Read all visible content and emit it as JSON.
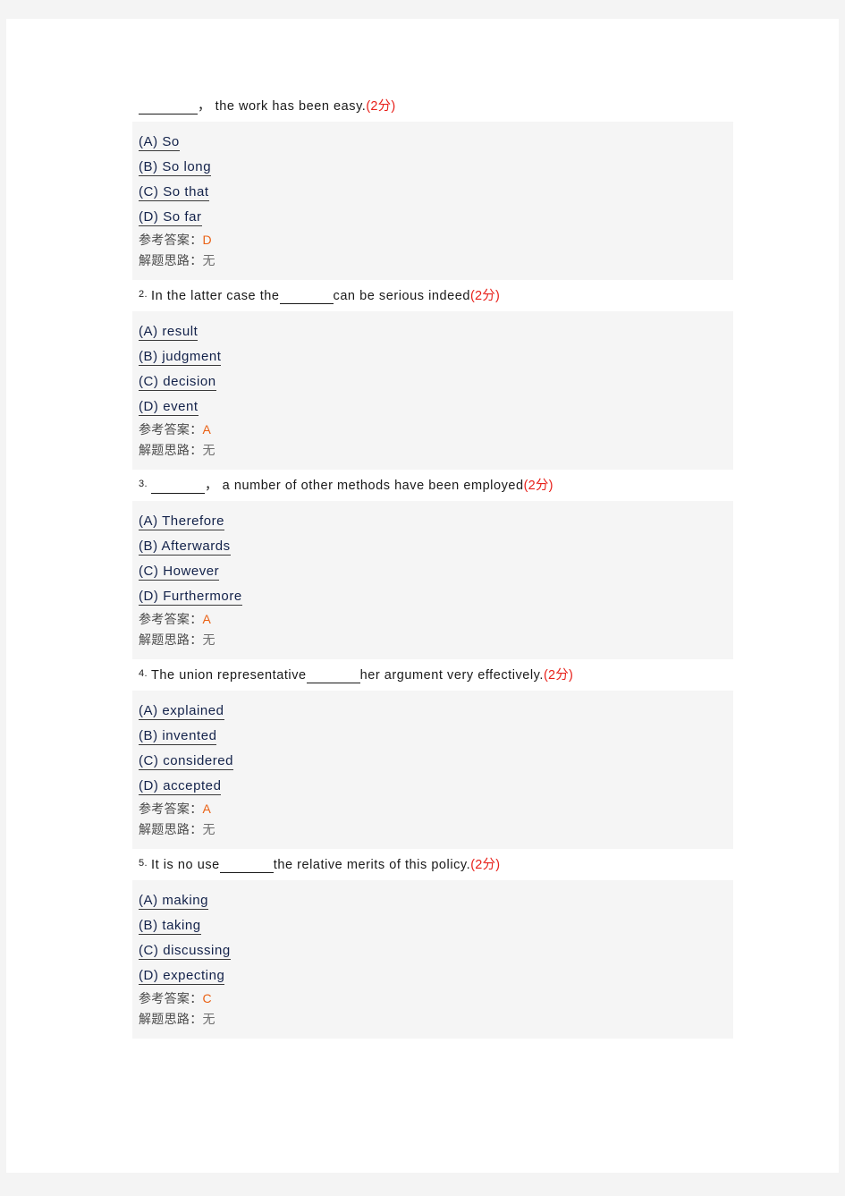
{
  "page": {
    "background_color": "#f4f4f4",
    "paper_color": "#ffffff",
    "block_color": "#f5f5f5",
    "points_color": "#e8201a",
    "answer_color": "#ea6216",
    "option_color": "#13224a"
  },
  "labels": {
    "answer_label": "参考答案：",
    "explain_label": "解题思路：",
    "explain_value": "无",
    "points": "(2分)"
  },
  "questions": [
    {
      "number": "",
      "stem_before": "",
      "stem_after": "， the work has been easy.",
      "truncated": true,
      "points": "(2分)",
      "options": [
        "(A)  So ",
        "(B)  So  long",
        "(C)  So  that",
        "(D)  So  far"
      ],
      "answer": "D",
      "explain": "无"
    },
    {
      "number": "2.",
      "stem_before": "In the latter case the",
      "stem_after": "can be serious indeed",
      "truncated": false,
      "points": "(2分)",
      "options": [
        "(A)  result ",
        "(B)  judgment ",
        "(C)  decision ",
        "(D)  event"
      ],
      "answer": "A",
      "explain": "无"
    },
    {
      "number": "3.",
      "stem_before": "",
      "stem_after": "， a number of other methods have been employed",
      "truncated": false,
      "points": "(2分)",
      "options": [
        "(A)  Therefore ",
        "(B)  Afterwards ",
        "(C)  However ",
        "(D)  Furthermore"
      ],
      "answer": "A",
      "explain": "无"
    },
    {
      "number": "4.",
      "stem_before": "The union representative",
      "stem_after": "her argument very effectively.",
      "truncated": false,
      "points": "(2分)",
      "options": [
        "(A)  explained ",
        "(B)  invented ",
        "(C)  considered ",
        "(D)  accepted"
      ],
      "answer": "A",
      "explain": "无"
    },
    {
      "number": "5.",
      "stem_before": "It is no use",
      "stem_after": "the relative merits of this policy.",
      "truncated": false,
      "points": "(2分)",
      "options": [
        "(A)  making ",
        "(B)  taking ",
        "(C)  discussing ",
        "(D)  expecting"
      ],
      "answer": "C",
      "explain": "无"
    }
  ]
}
